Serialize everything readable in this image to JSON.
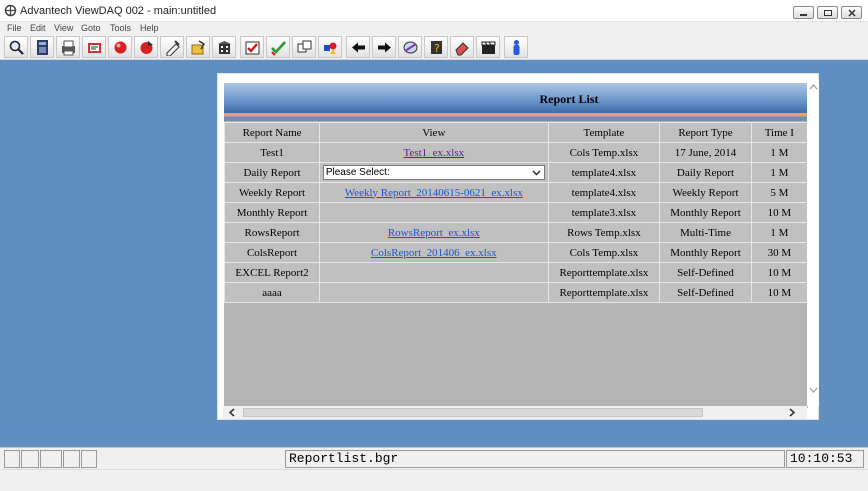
{
  "window": {
    "title": "Advantech ViewDAQ 002 - main:untitled"
  },
  "menu": {
    "items": [
      "File",
      "Edit",
      "View",
      "Goto",
      "Tools",
      "Help"
    ]
  },
  "toolbar": {
    "icons": [
      "search-icon",
      "calculator-icon",
      "printer-icon",
      "report-icon",
      "red-ball-icon",
      "red-ball-arrow-icon",
      "edit-tag-icon",
      "folder-tag-icon",
      "building-icon",
      "red-check-icon",
      "green-check-icon",
      "windows-icon",
      "colored-shapes-icon",
      "left-arrow-icon",
      "right-arrow-icon",
      "globe-icon",
      "help-book-icon",
      "eraser-icon",
      "clapper-icon",
      "person-icon"
    ]
  },
  "report": {
    "title": "Report List",
    "columns": [
      "Report Name",
      "View",
      "Template",
      "Report Type",
      "Time I"
    ],
    "rows": [
      {
        "name": "Test1",
        "view": "Test1_ex.xlsx",
        "view_visited": true,
        "template": "Cols Temp.xlsx",
        "type": "17 June, 2014",
        "time": "1 M"
      },
      {
        "name": "Daily Report",
        "view_select": "Please Select:",
        "template": "template4.xlsx",
        "type": "Daily Report",
        "time": "1 M"
      },
      {
        "name": "Weekly Report",
        "view": "Weekly Report_20140615-0621_ex.xlsx",
        "template": "template4.xlsx",
        "type": "Weekly Report",
        "time": "5 M"
      },
      {
        "name": "Monthly Report",
        "view": "",
        "template": "template3.xlsx",
        "type": "Monthly Report",
        "time": "10 M"
      },
      {
        "name": "RowsReport",
        "view": "RowsReport_ex.xlsx",
        "template": "Rows Temp.xlsx",
        "type": "Multi-Time",
        "time": "1 M"
      },
      {
        "name": "ColsReport",
        "view": "ColsReport_201406_ex.xlsx",
        "template": "Cols Temp.xlsx",
        "type": "Monthly Report",
        "time": "30 M"
      },
      {
        "name": "EXCEL Report2",
        "view": "",
        "template": "Reporttemplate.xlsx",
        "type": "Self-Defined",
        "time": "10 M"
      },
      {
        "name": "aaaa",
        "view": "",
        "template": "Reporttemplate.xlsx",
        "type": "Self-Defined",
        "time": "10 M"
      }
    ]
  },
  "status": {
    "filename": "Reportlist.bgr",
    "time": "10:10:53"
  },
  "colors": {
    "workspace": "#5f8fc0",
    "link": "#1a56c8",
    "visited_link": "#6a1a88",
    "table_bg": "#c0c0c0"
  }
}
